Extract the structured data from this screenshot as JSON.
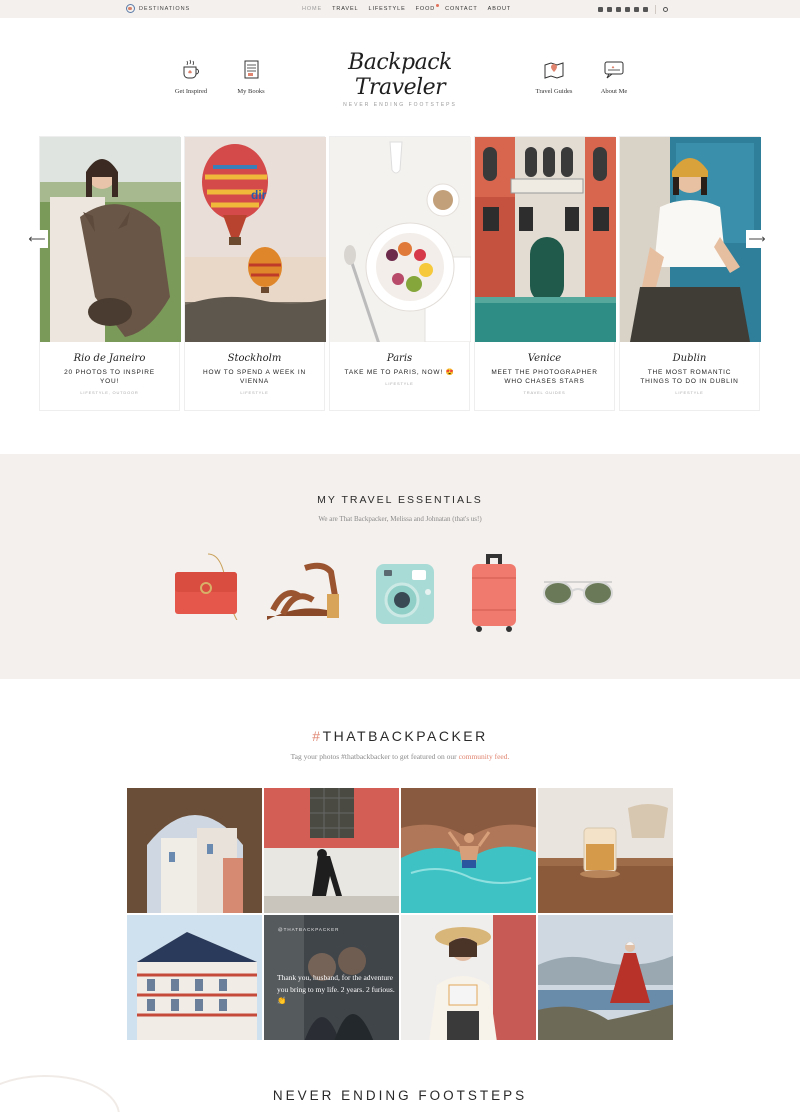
{
  "topbar": {
    "destinations": "Destinations",
    "nav": [
      "Home",
      "Travel",
      "Lifestyle",
      "Food",
      "Contact",
      "About"
    ]
  },
  "header": {
    "left_links": [
      "Get Inspired",
      "My Books"
    ],
    "right_links": [
      "Travel Guides",
      "About Me"
    ],
    "logo": "Backpack Traveler",
    "tagline": "Never Ending Footsteps"
  },
  "carousel": {
    "cards": [
      {
        "city": "Rio de Janeiro",
        "title": "20 PHOTOS TO INSPIRE YOU!",
        "category": "Lifestyle, Outdoor"
      },
      {
        "city": "Stockholm",
        "title": "HOW TO SPEND A WEEK IN VIENNA",
        "category": "Lifestyle"
      },
      {
        "city": "Paris",
        "title": "TAKE ME TO PARIS, NOW! 😍",
        "category": "Lifestyle"
      },
      {
        "city": "Venice",
        "title": "MEET THE PHOTOGRAPHER WHO CHASES STARS",
        "category": "Travel Guides"
      },
      {
        "city": "Dublin",
        "title": "THE MOST ROMANTIC THINGS TO DO IN DUBLIN",
        "category": "Lifestyle"
      }
    ]
  },
  "essentials": {
    "title": "MY TRAVEL ESSENTIALS",
    "subtitle": "We are That Backpacker, Melissa and Johnatan (that's us!)"
  },
  "hashtag": {
    "title_symbol": "#",
    "title_text": "THATBACKPACKER",
    "subtitle": "Tag your photos #thatbackbacker to get featured on our",
    "subtitle_link": "community feed."
  },
  "instagram_overlay": {
    "handle": "@THATBACKPACKER",
    "caption": "Thank you, husband, for the adventure you bring to my life. 2 years. 2 furious. 👏"
  },
  "footer": {
    "title": "NEVER ENDING FOOTSTEPS"
  },
  "colors": {
    "accent": "#e0846f",
    "beige": "#f4f0ed"
  }
}
